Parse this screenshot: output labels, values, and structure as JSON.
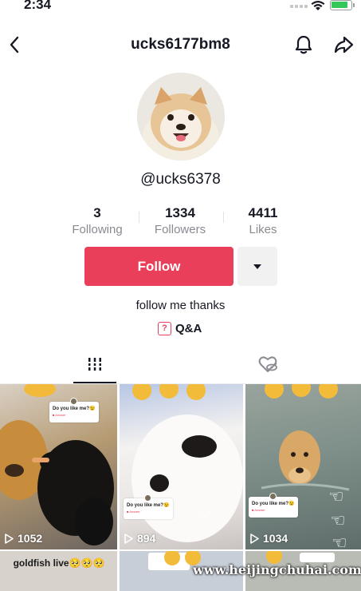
{
  "status_bar": {
    "time": "2:34",
    "battery_color": "#35c759"
  },
  "nav": {
    "title": "ucks6177bm8",
    "back_icon": "chevron-left-icon",
    "bell_icon": "bell-icon",
    "share_icon": "share-arrow-icon"
  },
  "profile": {
    "handle": "@ucks6378",
    "bio": "follow me thanks",
    "qa_label": "Q&A",
    "qa_icon_glyph": "?"
  },
  "stats": [
    {
      "value": "3",
      "label": "Following"
    },
    {
      "value": "1334",
      "label": "Followers"
    },
    {
      "value": "4411",
      "label": "Likes"
    }
  ],
  "actions": {
    "follow_label": "Follow",
    "accent": "#ea3f5a"
  },
  "tabs": {
    "videos_icon": "grid-bars-icon",
    "liked_icon": "hidden-heart-icon"
  },
  "videos": [
    {
      "plays": "1052",
      "question": "Do you like me?😉",
      "answer": "■ Answer"
    },
    {
      "plays": "894",
      "question": "Do you like me?😉",
      "answer": "■ Answer"
    },
    {
      "plays": "1034",
      "question": "Do you like me?😉",
      "answer": "■ Answer"
    },
    {
      "caption": "goldfish live🥺🥺🥺"
    }
  ],
  "watermark": "www.heijingchuhai.com"
}
